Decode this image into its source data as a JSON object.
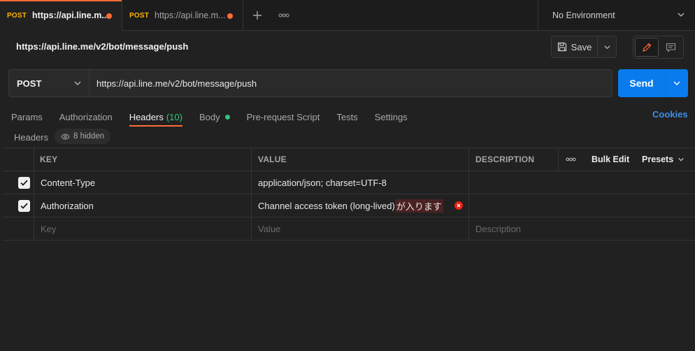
{
  "tabs": [
    {
      "method": "POST",
      "title": "https://api.line.m..."
    },
    {
      "method": "POST",
      "title": "https://api.line.m..."
    }
  ],
  "environment": {
    "label": "No Environment"
  },
  "request": {
    "name": "https://api.line.me/v2/bot/message/push",
    "method": "POST",
    "url": "https://api.line.me/v2/bot/message/push"
  },
  "toolbar": {
    "save_label": "Save",
    "send_label": "Send"
  },
  "subtabs": [
    {
      "label": "Params"
    },
    {
      "label": "Authorization"
    },
    {
      "label": "Headers",
      "count": "(10)"
    },
    {
      "label": "Body"
    },
    {
      "label": "Pre-request Script"
    },
    {
      "label": "Tests"
    },
    {
      "label": "Settings"
    }
  ],
  "cookies_label": "Cookies",
  "headers_meta": {
    "label": "Headers",
    "hidden": "8 hidden"
  },
  "table": {
    "columns": {
      "key": "KEY",
      "value": "VALUE",
      "description": "DESCRIPTION"
    },
    "bulk_edit": "Bulk Edit",
    "presets": "Presets",
    "rows": [
      {
        "key": "Content-Type",
        "value": "application/json; charset=UTF-8",
        "description": "",
        "checked": true
      },
      {
        "key": "Authorization",
        "value_prefix": "Channel access token (long-lived)",
        "value_highlight": "が入ります",
        "description": "",
        "checked": true
      }
    ],
    "placeholders": {
      "key": "Key",
      "value": "Value",
      "description": "Description"
    }
  },
  "colors": {
    "accent": "#ff6c37",
    "send": "#097bed",
    "success": "#34c47c",
    "error": "#eb2013",
    "method": "#ffb400"
  }
}
